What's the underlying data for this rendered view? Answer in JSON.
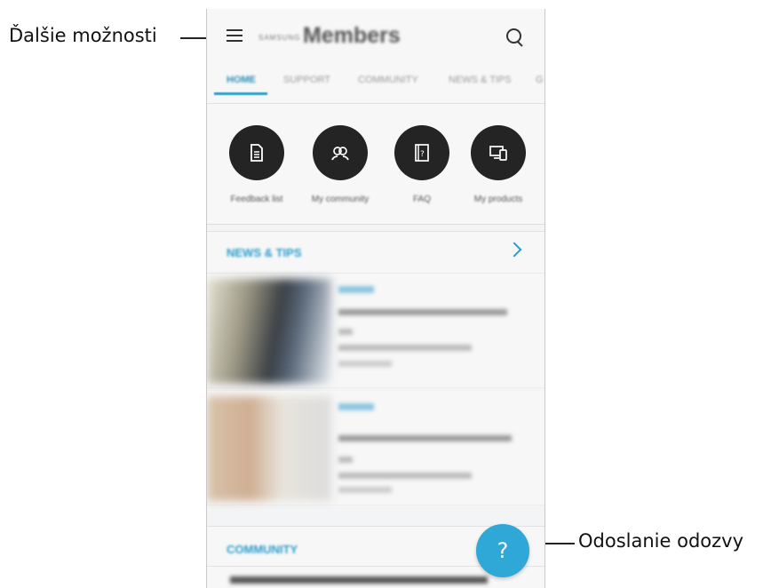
{
  "callouts": {
    "more_options": "Ďalšie možnosti",
    "send_feedback": "Odoslanie odozvy"
  },
  "app": {
    "brand_small": "SAMSUNG",
    "brand_name": "Members"
  },
  "tabs": [
    {
      "label": "HOME",
      "active": true
    },
    {
      "label": "SUPPORT",
      "active": false
    },
    {
      "label": "COMMUNITY",
      "active": false
    },
    {
      "label": "NEWS & TIPS",
      "active": false
    },
    {
      "label": "G",
      "active": false
    }
  ],
  "quick_actions": [
    {
      "label": "Feedback list",
      "icon": "document-icon"
    },
    {
      "label": "My community",
      "icon": "people-icon"
    },
    {
      "label": "FAQ",
      "icon": "faq-book-icon"
    },
    {
      "label": "My products",
      "icon": "devices-icon"
    }
  ],
  "sections": {
    "news_title": "NEWS & TIPS",
    "community_title": "COMMUNITY"
  },
  "fab": {
    "symbol": "?"
  },
  "colors": {
    "accent": "#2fa7d7",
    "icon_circle": "#242424"
  }
}
